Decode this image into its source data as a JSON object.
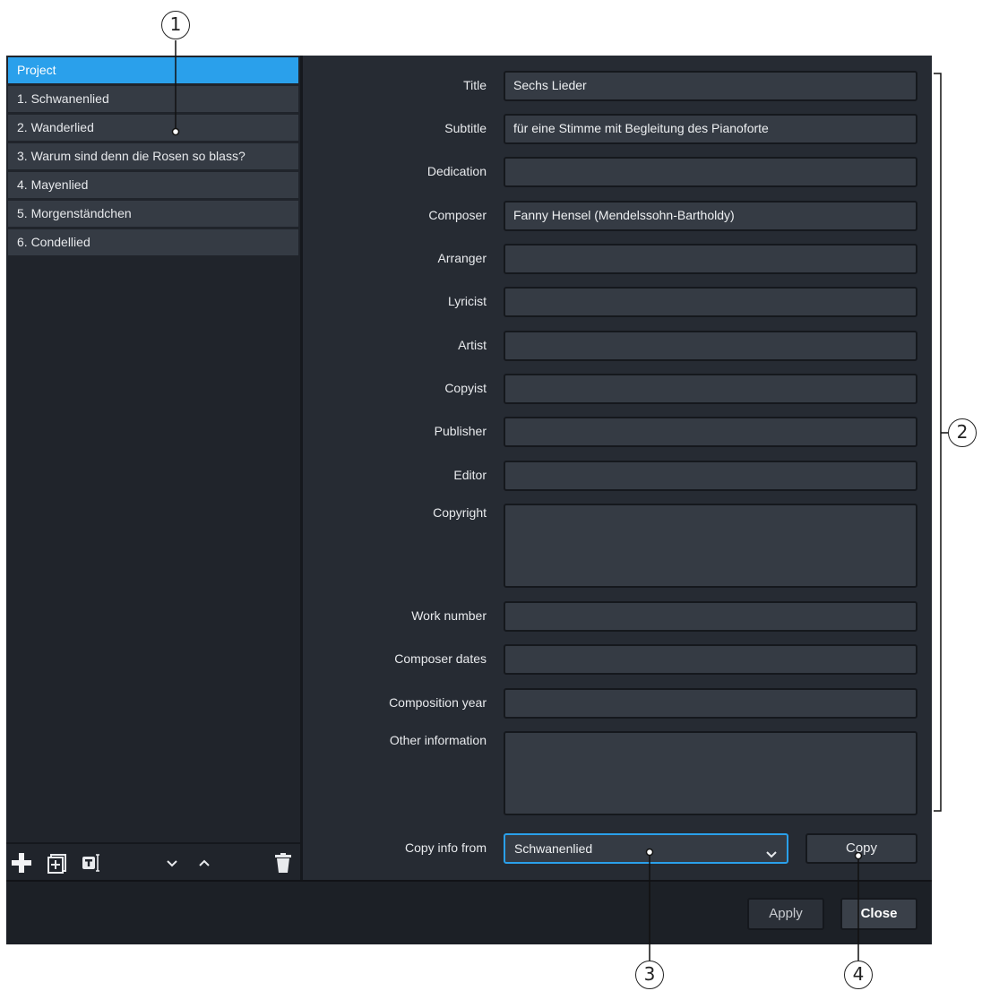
{
  "flows": {
    "items": [
      {
        "label": "Project"
      },
      {
        "label": "1. Schwanenlied"
      },
      {
        "label": "2. Wanderlied"
      },
      {
        "label": "3. Warum sind denn die Rosen so blass?"
      },
      {
        "label": "4. Mayenlied"
      },
      {
        "label": "5. Morgenständchen"
      },
      {
        "label": "6. Condellied"
      }
    ],
    "selected_index": 0
  },
  "toolbar": {
    "icons": [
      "add-icon",
      "add-flow-icon",
      "title-icon",
      "move-down-icon",
      "move-up-icon",
      "delete-icon"
    ]
  },
  "fields": [
    {
      "label": "Title",
      "value": "Sechs Lieder"
    },
    {
      "label": "Subtitle",
      "value": "für eine Stimme mit Begleitung des Pianoforte"
    },
    {
      "label": "Dedication",
      "value": ""
    },
    {
      "label": "Composer",
      "value": "Fanny Hensel (Mendelssohn-Bartholdy)"
    },
    {
      "label": "Arranger",
      "value": ""
    },
    {
      "label": "Lyricist",
      "value": ""
    },
    {
      "label": "Artist",
      "value": ""
    },
    {
      "label": "Copyist",
      "value": ""
    },
    {
      "label": "Publisher",
      "value": ""
    },
    {
      "label": "Editor",
      "value": ""
    },
    {
      "label": "Copyright",
      "value": ""
    },
    {
      "label": "Work number",
      "value": ""
    },
    {
      "label": "Composer dates",
      "value": ""
    },
    {
      "label": "Composition year",
      "value": ""
    },
    {
      "label": "Other information",
      "value": ""
    }
  ],
  "copy_info": {
    "label": "Copy info from",
    "selected": "Schwanenlied",
    "button": "Copy"
  },
  "footer": {
    "apply": "Apply",
    "close": "Close"
  },
  "callouts": [
    "1",
    "2",
    "3",
    "4"
  ],
  "colors": {
    "accent": "#2aa0eb",
    "background": "#20242b",
    "field": "#353b44"
  }
}
